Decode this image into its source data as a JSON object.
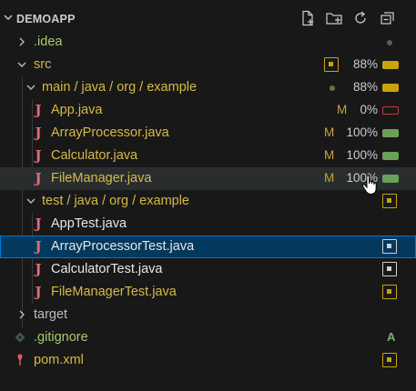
{
  "explorer": {
    "title": "DEMOAPP",
    "actions": [
      "new-file-icon",
      "new-folder-icon",
      "refresh-icon",
      "collapse-all-icon"
    ]
  },
  "tree": {
    "idea": {
      "label": ".idea"
    },
    "src": {
      "label": "src",
      "coverage": "88%"
    },
    "main": {
      "label": "main / java / org / example",
      "coverage": "88%"
    },
    "app": {
      "label": "App.java",
      "status": "M",
      "coverage": "0%"
    },
    "array": {
      "label": "ArrayProcessor.java",
      "status": "M",
      "coverage": "100%"
    },
    "calc": {
      "label": "Calculator.java",
      "status": "M",
      "coverage": "100%"
    },
    "file": {
      "label": "FileManager.java",
      "status": "M",
      "coverage": "100%"
    },
    "test": {
      "label": "test / java / org / example"
    },
    "apptest": {
      "label": "AppTest.java"
    },
    "arraytest": {
      "label": "ArrayProcessorTest.java"
    },
    "calctest": {
      "label": "CalculatorTest.java"
    },
    "filetest": {
      "label": "FileManagerTest.java"
    },
    "target": {
      "label": "target"
    },
    "gitignore": {
      "label": ".gitignore",
      "status": "A"
    },
    "pom": {
      "label": "pom.xml"
    }
  },
  "colors": {
    "background": "#181818",
    "selected": "#04395e",
    "modified": "#d7ba45",
    "untracked": "#a6c96a",
    "coverage_full": "#6aa05a",
    "coverage_partial": "#c9a30f",
    "coverage_none": "#c73c3c"
  }
}
